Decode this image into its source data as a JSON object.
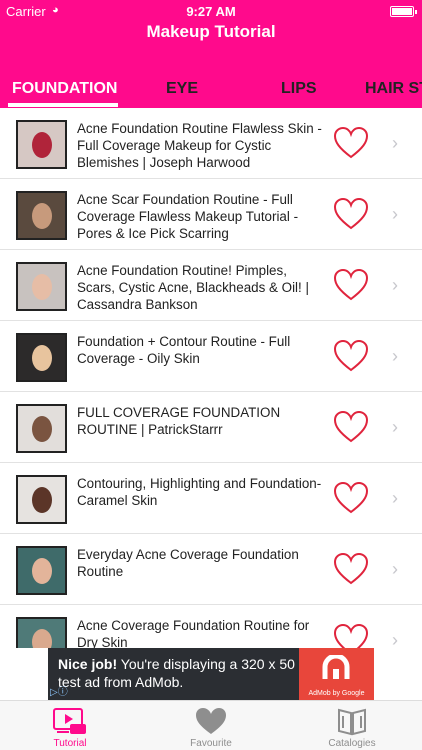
{
  "status_bar": {
    "carrier": "Carrier",
    "time": "9:27 AM"
  },
  "nav": {
    "title": "Makeup Tutorial"
  },
  "tabs": [
    {
      "label": "FOUNDATION",
      "active": true
    },
    {
      "label": "EYE",
      "active": false
    },
    {
      "label": "LIPS",
      "active": false
    },
    {
      "label": "HAIR ST",
      "active": false
    }
  ],
  "videos": [
    {
      "title": "Acne Foundation Routine Flawless Skin - Full Coverage Makeup for Cystic Blemishes | Joseph Harwood",
      "favorite_icon": "heart-outline-icon"
    },
    {
      "title": "Acne Scar Foundation Routine - Full Coverage Flawless Makeup Tutorial - Pores & Ice Pick Scarring",
      "favorite_icon": "heart-outline-icon"
    },
    {
      "title": "Acne Foundation Routine! Pimples, Scars, Cystic Acne, Blackheads & Oil! | Cassandra Bankson",
      "favorite_icon": "heart-outline-icon"
    },
    {
      "title": "Foundation + Contour Routine - Full Coverage - Oily Skin",
      "favorite_icon": "heart-outline-icon"
    },
    {
      "title": "FULL COVERAGE FOUNDATION ROUTINE | PatrickStarrr",
      "favorite_icon": "heart-outline-icon"
    },
    {
      "title": "Contouring, Highlighting and Foundation- Caramel Skin",
      "favorite_icon": "heart-outline-icon"
    },
    {
      "title": "Everyday Acne Coverage Foundation Routine",
      "favorite_icon": "heart-outline-icon"
    },
    {
      "title": "Acne Coverage Foundation Routine for Dry Skin",
      "favorite_icon": "heart-outline-icon"
    }
  ],
  "ad": {
    "headline": "Nice job!",
    "body": " You're displaying a 320 x 50 test ad from AdMob.",
    "brand": "AdMob by Google"
  },
  "tab_bar": [
    {
      "label": "Tutorial",
      "icon": "video-player-icon",
      "active": true
    },
    {
      "label": "Favourite",
      "icon": "heart-icon",
      "active": false
    },
    {
      "label": "Catalogies",
      "icon": "book-icon",
      "active": false
    }
  ],
  "colors": {
    "brand_pink": "#ff0a8c",
    "heart_red": "#e0243d"
  }
}
